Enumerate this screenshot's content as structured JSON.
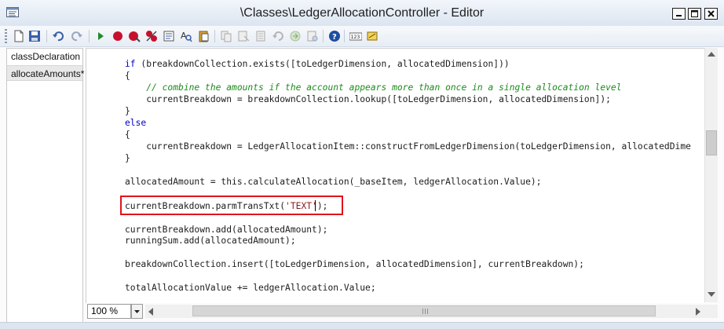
{
  "window": {
    "title": "\\Classes\\LedgerAllocationController - Editor",
    "controls": [
      "minimize-icon",
      "maximize-icon",
      "close-icon"
    ]
  },
  "toolbar": {
    "icons": [
      "new-icon",
      "save-icon",
      "undo-icon",
      "redo-icon",
      "run-icon",
      "breakpoint-icon",
      "remove-breakpoint-icon",
      "clear-breakpoints-icon",
      "lookup-icon",
      "find-icon",
      "paste-icon",
      "copy-icon",
      "cut-icon",
      "indent-icon",
      "outdent-icon",
      "compile-icon",
      "help-icon",
      "line-numbers-icon",
      "script-icon"
    ]
  },
  "methods": {
    "items": [
      "classDeclaration",
      "allocateAmounts*"
    ],
    "selected": "allocateAmounts*"
  },
  "code": {
    "lines": [
      "if (breakdownCollection.exists([toLedgerDimension, allocatedDimension]))",
      "{",
      "    // combine the amounts if the account appears more than once in a single allocation level",
      "    currentBreakdown = breakdownCollection.lookup([toLedgerDimension, allocatedDimension]);",
      "}",
      "else",
      "{",
      "    currentBreakdown = LedgerAllocationItem::constructFromLedgerDimension(toLedgerDimension, allocatedDime",
      "}",
      "allocatedAmount = this.calculateAllocation(_baseItem, ledgerAllocation.Value);",
      "currentBreakdown.parmTransTxt('TEXT');",
      "currentBreakdown.add(allocatedAmount);",
      "runningSum.add(allocatedAmount);",
      "breakdownCollection.insert([toLedgerDimension, allocatedDimension], currentBreakdown);",
      "totalAllocationValue += ledgerAllocation.Value;"
    ]
  },
  "zoom": {
    "value": "100 %"
  },
  "colors": {
    "keyword": "#0000c8",
    "comment": "#1d8a1d",
    "highlight_border": "#e0141c"
  }
}
